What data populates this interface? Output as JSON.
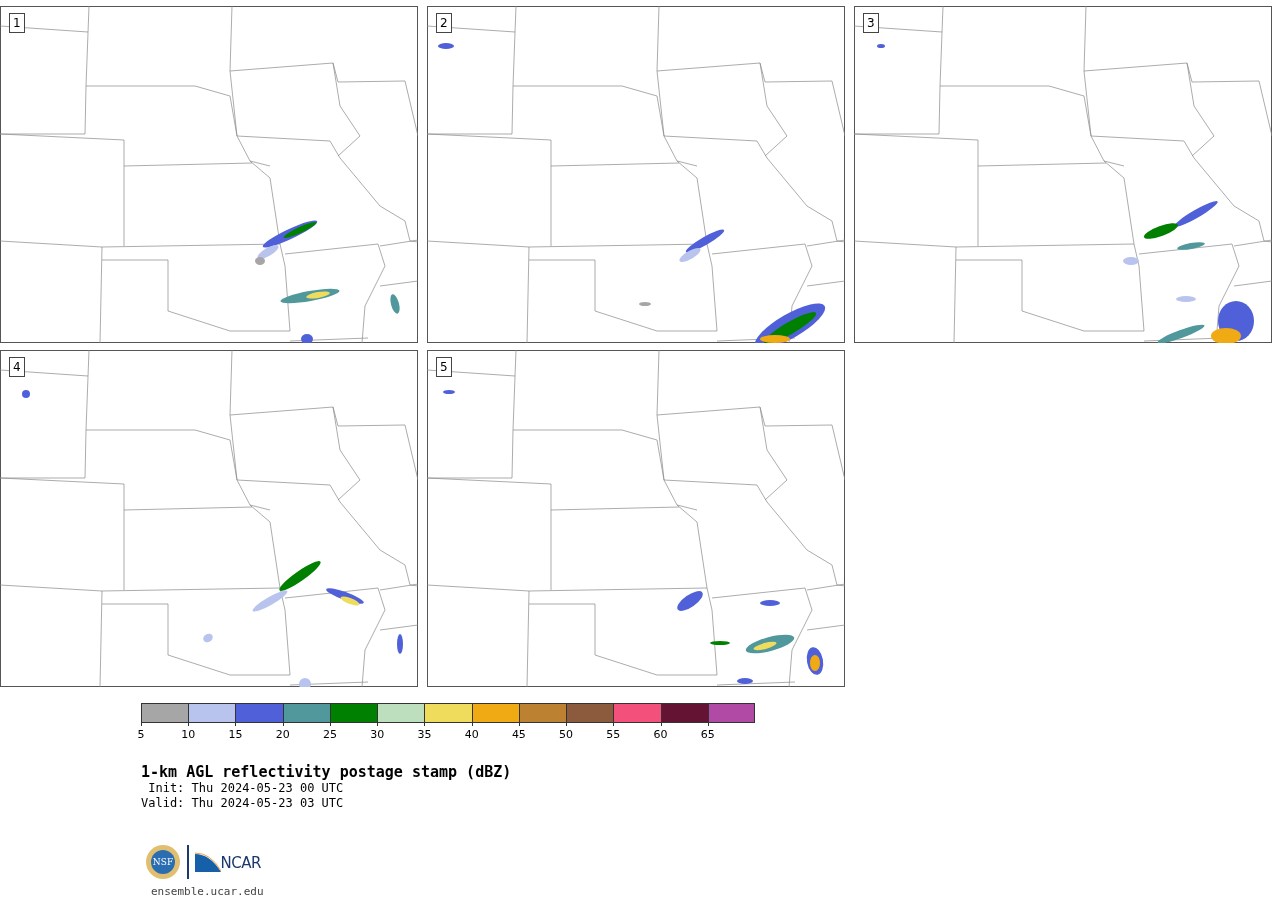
{
  "panels": [
    {
      "label": "1"
    },
    {
      "label": "2"
    },
    {
      "label": "3"
    },
    {
      "label": "4"
    },
    {
      "label": "5"
    }
  ],
  "colorbar": {
    "bins": [
      {
        "color": "#a6a6a6",
        "tick": "5"
      },
      {
        "color": "#b8c3ee",
        "tick": "10"
      },
      {
        "color": "#5060d8",
        "tick": "15"
      },
      {
        "color": "#50989c",
        "tick": "20"
      },
      {
        "color": "#008000",
        "tick": "25"
      },
      {
        "color": "#bedfbe",
        "tick": "30"
      },
      {
        "color": "#f0dc5c",
        "tick": "35"
      },
      {
        "color": "#f0aa14",
        "tick": "40"
      },
      {
        "color": "#bc8232",
        "tick": "45"
      },
      {
        "color": "#8c5a3c",
        "tick": "50"
      },
      {
        "color": "#f4507c",
        "tick": "55"
      },
      {
        "color": "#641432",
        "tick": "60"
      },
      {
        "color": "#b04aa4",
        "tick": "65"
      }
    ]
  },
  "title": "1-km AGL reflectivity postage stamp (dBZ)",
  "init": "Init: Thu 2024-05-23 00 UTC",
  "valid": "Valid: Thu 2024-05-23 03 UTC",
  "logos": {
    "nsf": "NSF",
    "ncar": "NCAR"
  },
  "link": "ensemble.ucar.edu"
}
